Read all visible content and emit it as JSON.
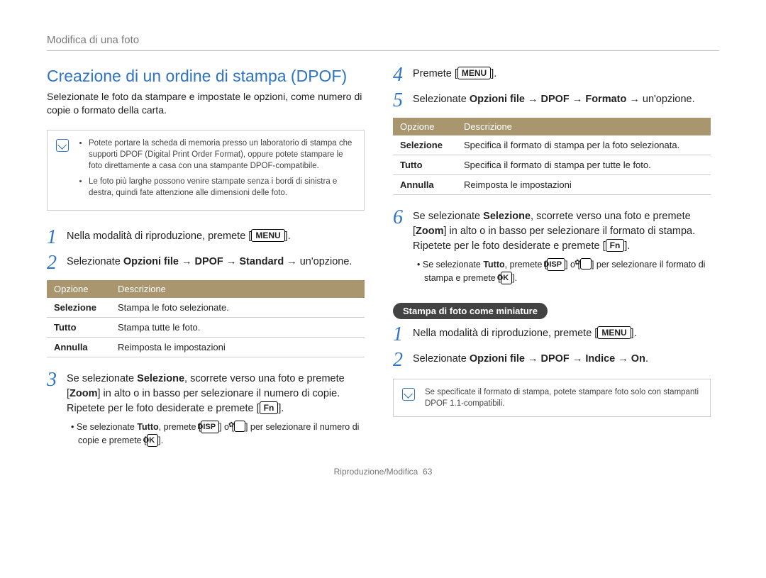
{
  "header": "Modifica di una foto",
  "section_title": "Creazione di un ordine di stampa (DPOF)",
  "intro": "Selezionate le foto da stampare e impostate le opzioni, come numero di copie o formato della carta.",
  "note1": {
    "items": [
      "Potete portare la scheda di memoria presso un laboratorio di stampa che supporti DPOF (Digital Print Order Format), oppure potete stampare le foto direttamente a casa con una stampante DPOF-compatibile.",
      "Le foto più larghe possono venire stampate senza i bordi di sinistra e destra, quindi fate attenzione alle dimensioni delle foto."
    ]
  },
  "left_steps": {
    "s1_a": "Nella modalità di riproduzione, premete [",
    "s1_key": "MENU",
    "s1_b": "].",
    "s2_a": "Selezionate ",
    "s2_bold": "Opzioni file → DPOF → Standard →",
    "s2_b": " un'opzione.",
    "table": {
      "head": [
        "Opzione",
        "Descrizione"
      ],
      "rows": [
        [
          "Selezione",
          "Stampa le foto selezionate."
        ],
        [
          "Tutto",
          "Stampa tutte le foto."
        ],
        [
          "Annulla",
          "Reimposta le impostazioni"
        ]
      ]
    },
    "s3_a": "Se selezionate ",
    "s3_b1": "Selezione",
    "s3_c": ", scorrete verso una foto e premete [",
    "s3_b2": "Zoom",
    "s3_d": "] in alto o in basso per selezionare il numero di copie. Ripetete per le foto desiderate e premete [",
    "s3_key": "Fn",
    "s3_e": "].",
    "s3_sub_a": "Se selezionate ",
    "s3_sub_b1": "Tutto",
    "s3_sub_b": ", premete [",
    "s3_sub_key1": "DISP",
    "s3_sub_c": "] o [",
    "s3_sub_d": "] per selezionare il numero di copie e premete [",
    "s3_sub_key2": "OK",
    "s3_sub_e": "]."
  },
  "right_steps": {
    "s4_a": "Premete [",
    "s4_key": "MENU",
    "s4_b": "].",
    "s5_a": "Selezionate ",
    "s5_bold": "Opzioni file → DPOF → Formato →",
    "s5_b": " un'opzione.",
    "table": {
      "head": [
        "Opzione",
        "Descrizione"
      ],
      "rows": [
        [
          "Selezione",
          "Specifica il formato di stampa per la foto selezionata."
        ],
        [
          "Tutto",
          "Specifica il formato di stampa per tutte le foto."
        ],
        [
          "Annulla",
          "Reimposta le impostazioni"
        ]
      ]
    },
    "s6_a": "Se selezionate ",
    "s6_b1": "Selezione",
    "s6_c": ", scorrete verso una foto e premete [",
    "s6_b2": "Zoom",
    "s6_d": "] in alto o in basso per selezionare il formato di stampa. Ripetete per le foto desiderate e premete [",
    "s6_key": "Fn",
    "s6_e": "].",
    "s6_sub_a": "Se selezionate ",
    "s6_sub_b1": "Tutto",
    "s6_sub_b": ", premete [",
    "s6_sub_key1": "DISP",
    "s6_sub_c": "] o [",
    "s6_sub_d": "] per selezionare il formato di stampa e premete [",
    "s6_sub_key2": "OK",
    "s6_sub_e": "].",
    "pill": "Stampa di foto come miniature",
    "m1_a": "Nella modalità di riproduzione, premete [",
    "m1_key": "MENU",
    "m1_b": "].",
    "m2_a": "Selezionate ",
    "m2_bold": "Opzioni file → DPOF → Indice → On",
    "m2_b": "."
  },
  "note2": "Se specificate il formato di stampa, potete stampare foto solo con stampanti DPOF 1.1-compatibili.",
  "footer_label": "Riproduzione/Modifica",
  "footer_page": "63"
}
